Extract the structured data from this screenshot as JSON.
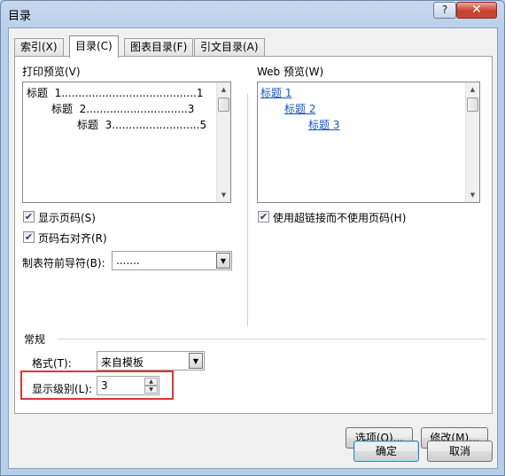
{
  "window": {
    "title": "目录",
    "help": "?",
    "close": "✕"
  },
  "tabs": [
    "索引(X)",
    "目录(C)",
    "图表目录(F)",
    "引文目录(A)"
  ],
  "print_preview": {
    "label": "打印预览(V)",
    "lines": [
      "标题  1........................................1",
      "标题  2..............................3",
      "标题  3..........................5"
    ]
  },
  "web_preview": {
    "label": "Web 预览(W)",
    "links": [
      "标题  1",
      "标题  2",
      "标题  3"
    ]
  },
  "options": {
    "show_page_numbers": {
      "label": "显示页码(S)",
      "checked": true
    },
    "right_align": {
      "label": "页码右对齐(R)",
      "checked": true
    },
    "tab_leader_label": "制表符前导符(B):",
    "tab_leader_value": ".......",
    "use_hyperlinks": {
      "label": "使用超链接而不使用页码(H)",
      "checked": true
    }
  },
  "general": {
    "heading": "常规",
    "format_label": "格式(T):",
    "format_value": "来自模板",
    "levels_label": "显示级别(L):",
    "levels_value": "3"
  },
  "buttons": {
    "options": "选项(O)...",
    "modify": "修改(M)...",
    "ok": "确定",
    "cancel": "取消"
  },
  "icons": {
    "check": "✔",
    "dropdown": "▼",
    "up": "▲",
    "down": "▼"
  }
}
